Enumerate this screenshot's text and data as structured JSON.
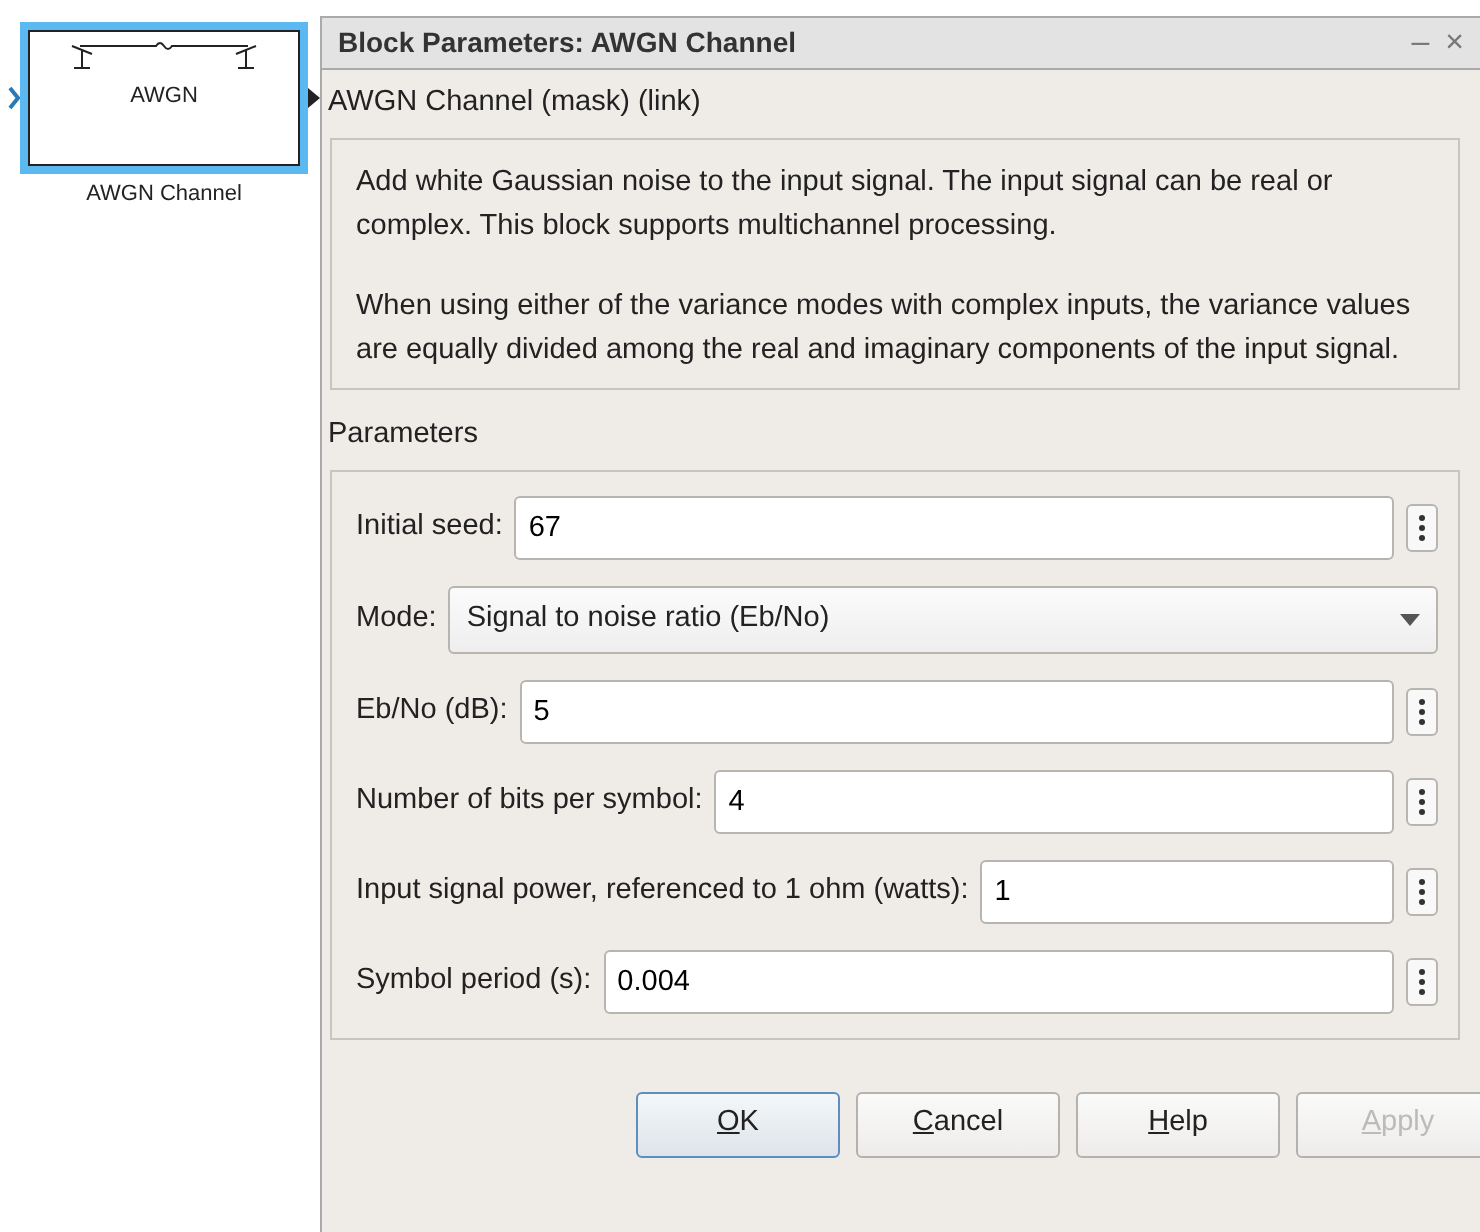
{
  "block": {
    "name": "AWGN",
    "caption": "AWGN Channel",
    "selected": true
  },
  "dialog": {
    "title": "Block Parameters: AWGN Channel",
    "minimize": "–",
    "close": "×",
    "subtitle": "AWGN Channel (mask) (link)",
    "description": [
      "Add white Gaussian noise to the input signal. The input signal can be real or complex. This block supports multichannel processing.",
      "When using either of the variance modes with complex inputs, the variance values are equally divided among the real and imaginary components of the input signal."
    ],
    "parameters_label": "Parameters",
    "parameters": [
      {
        "kind": "edit",
        "label": "Initial seed:",
        "value": "67"
      },
      {
        "kind": "popup",
        "label": "Mode:",
        "value": "Signal to noise ratio  (Eb/No)"
      },
      {
        "kind": "edit",
        "label": "Eb/No (dB):",
        "value": "5"
      },
      {
        "kind": "edit",
        "label": "Number of bits per symbol:",
        "value": "4"
      },
      {
        "kind": "edit",
        "label": "Input signal power, referenced to 1 ohm (watts):",
        "value": "1"
      },
      {
        "kind": "edit",
        "label": "Symbol period (s):",
        "value": "0.004"
      }
    ],
    "buttons": [
      {
        "label": "OK",
        "default": true,
        "disabled": false
      },
      {
        "label": "Cancel",
        "default": false,
        "disabled": false
      },
      {
        "label": "Help",
        "default": false,
        "disabled": false
      },
      {
        "label": "Apply",
        "default": false,
        "disabled": true
      }
    ]
  }
}
